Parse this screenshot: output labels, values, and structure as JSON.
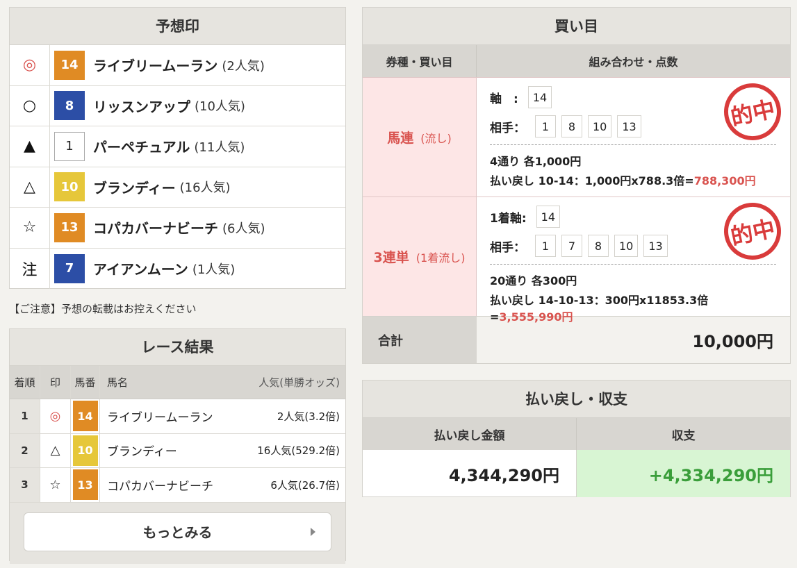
{
  "prediction": {
    "title": "予想印",
    "rows": [
      {
        "mark": "◎",
        "num": "14",
        "name": "ライブリームーラン",
        "pop": "(2人気)",
        "badge_color": "#e08b24"
      },
      {
        "mark": "○",
        "num": "8",
        "name": "リッスンアップ",
        "pop": "(10人気)",
        "badge_color": "#2c4ea6"
      },
      {
        "mark": "▲",
        "num": "1",
        "name": "パーペチュアル",
        "pop": "(11人気)",
        "badge_color": "#ffffff"
      },
      {
        "mark": "△",
        "num": "10",
        "name": "ブランディー",
        "pop": "(16人気)",
        "badge_color": "#e6c73a"
      },
      {
        "mark": "☆",
        "num": "13",
        "name": "コパカバーナビーチ",
        "pop": "(6人気)",
        "badge_color": "#e08b24"
      },
      {
        "mark": "注",
        "num": "7",
        "name": "アイアンムーン",
        "pop": "(1人気)",
        "badge_color": "#2c4ea6"
      }
    ]
  },
  "notice": "【ご注意】予想の転載はお控えください",
  "race_result": {
    "title": "レース結果",
    "headers": {
      "order": "着順",
      "mark": "印",
      "num": "馬番",
      "name": "馬名",
      "pop": "人気(単勝オッズ)"
    },
    "rows": [
      {
        "order": "1",
        "mark": "◎",
        "num": "14",
        "name": "ライブリームーラン",
        "pop": "2人気(3.2倍)",
        "badge_color": "#e08b24"
      },
      {
        "order": "2",
        "mark": "△",
        "num": "10",
        "name": "ブランディー",
        "pop": "16人気(529.2倍)",
        "badge_color": "#e6c73a"
      },
      {
        "order": "3",
        "mark": "☆",
        "num": "13",
        "name": "コパカバーナビーチ",
        "pop": "6人気(26.7倍)",
        "badge_color": "#e08b24"
      }
    ],
    "more_label": "もっとみる"
  },
  "bets": {
    "title": "買い目",
    "header_left": "券種・買い目",
    "header_right": "組み合わせ・点数",
    "rows": [
      {
        "type": "馬連",
        "sub": "(流し)",
        "axis_label": "軸　:",
        "axis": [
          "14"
        ],
        "partner_label": "相手：",
        "partners": [
          "1",
          "8",
          "10",
          "13"
        ],
        "count_line": "4通り 各1,000円",
        "payout_prefix": "払い戻し 10-14：1,000円x788.3倍=",
        "payout_amount": "788,300円",
        "stamp": "的中"
      },
      {
        "type": "3連単",
        "sub": "(1着流し)",
        "axis_label": "1着軸:",
        "axis": [
          "14"
        ],
        "partner_label": "相手：",
        "partners": [
          "1",
          "7",
          "8",
          "10",
          "13"
        ],
        "count_line": "20通り 各300円",
        "payout_prefix": "払い戻し 14-10-13：300円x11853.3倍=",
        "payout_amount": "3,555,990円",
        "stamp": "的中"
      }
    ],
    "total_label": "合計",
    "total_value": "10,000円"
  },
  "payback": {
    "title": "払い戻し・収支",
    "amount_label": "払い戻し金額",
    "balance_label": "収支",
    "amount_value": "4,344,290円",
    "balance_value": "+4,334,290円"
  }
}
